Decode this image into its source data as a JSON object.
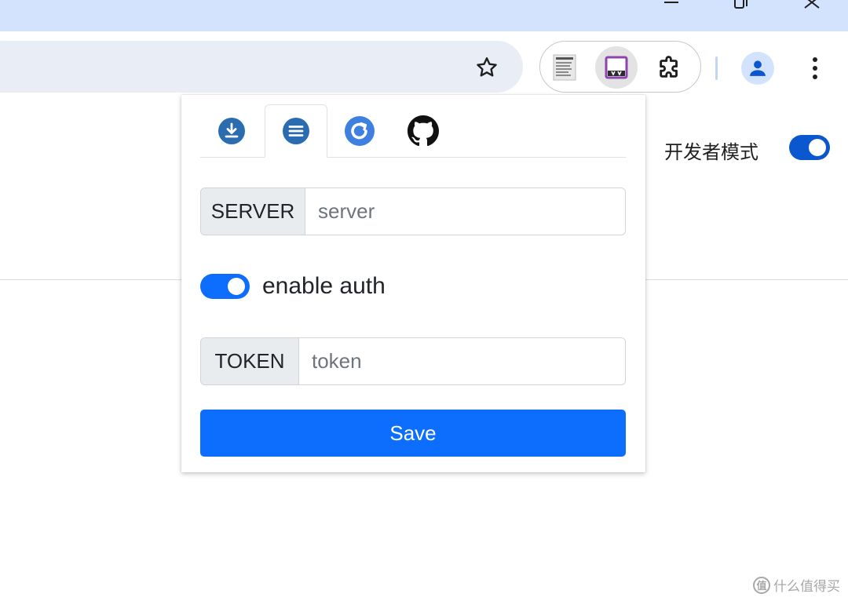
{
  "browser": {
    "colors": {
      "titlebar": "#d3e3fd",
      "accent": "#0b57d0"
    },
    "window_controls": [
      "minimize-icon",
      "restore-icon",
      "close-icon"
    ],
    "toolbar_icons": [
      "star-icon",
      "extension-doc-icon",
      "extension-aria2-icon",
      "puzzle-icon",
      "profile-icon",
      "more-vertical-icon"
    ]
  },
  "page": {
    "developer_mode_label": "开发者模式",
    "developer_mode_on": true
  },
  "popup": {
    "tabs": [
      {
        "icon": "download-icon",
        "active": false
      },
      {
        "icon": "list-icon",
        "active": true
      },
      {
        "icon": "refresh-icon",
        "active": false
      },
      {
        "icon": "github-icon",
        "active": false
      }
    ],
    "server": {
      "label": "SERVER",
      "placeholder": "server",
      "value": ""
    },
    "auth": {
      "label": "enable auth",
      "enabled": true
    },
    "token": {
      "label": "TOKEN",
      "placeholder": "token",
      "value": ""
    },
    "save_label": "Save",
    "colors": {
      "primary": "#0d6efd"
    }
  },
  "watermark": {
    "logo_glyph": "值",
    "text": "什么值得买"
  }
}
